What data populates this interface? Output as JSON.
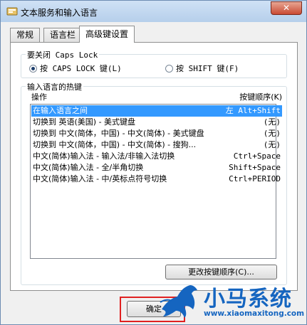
{
  "window": {
    "title": "文本服务和输入语言",
    "close_glyph": "✕"
  },
  "tabs": [
    {
      "label": "常规",
      "active": false
    },
    {
      "label": "语言栏",
      "active": false
    },
    {
      "label": "高级键设置",
      "active": true
    }
  ],
  "caps_lock": {
    "title": "要关闭 Caps Lock",
    "options": [
      {
        "label": "按 CAPS LOCK 键(L)",
        "selected": true
      },
      {
        "label": "按 SHIFT 键(F)",
        "selected": false
      }
    ]
  },
  "hotkeys": {
    "title": "输入语言的热键",
    "column_action": "操作",
    "column_keys": "按键顺序(K)",
    "rows": [
      {
        "action": "在输入语言之间",
        "keys": "左 Alt+Shift",
        "selected": true
      },
      {
        "action": "切换到 英语(美国) - 美式键盘",
        "keys": "(无)",
        "selected": false
      },
      {
        "action": "切换到 中文(简体，中国) - 中文(简体) - 美式键盘",
        "keys": "(无)",
        "selected": false
      },
      {
        "action": "切换到 中文(简体，中国) - 中文(简体) - 搜狗...",
        "keys": "(无)",
        "selected": false
      },
      {
        "action": "中文(简体)输入法 - 输入法/非输入法切换",
        "keys": "Ctrl+Space",
        "selected": false
      },
      {
        "action": "中文(简体)输入法 - 全/半角切换",
        "keys": "Shift+Space",
        "selected": false
      },
      {
        "action": "中文(简体)输入法 - 中/英标点符号切换",
        "keys": "Ctrl+PERIOD",
        "selected": false
      }
    ],
    "change_button": "更改按键顺序(C)..."
  },
  "footer": {
    "ok_label": "确定"
  },
  "watermark": {
    "name": "小马系统",
    "url": "www.xiaomaxitong.com"
  },
  "colors": {
    "selection": "#3399ff",
    "watermark": "#1565c0",
    "highlight_frame": "#e02020"
  }
}
